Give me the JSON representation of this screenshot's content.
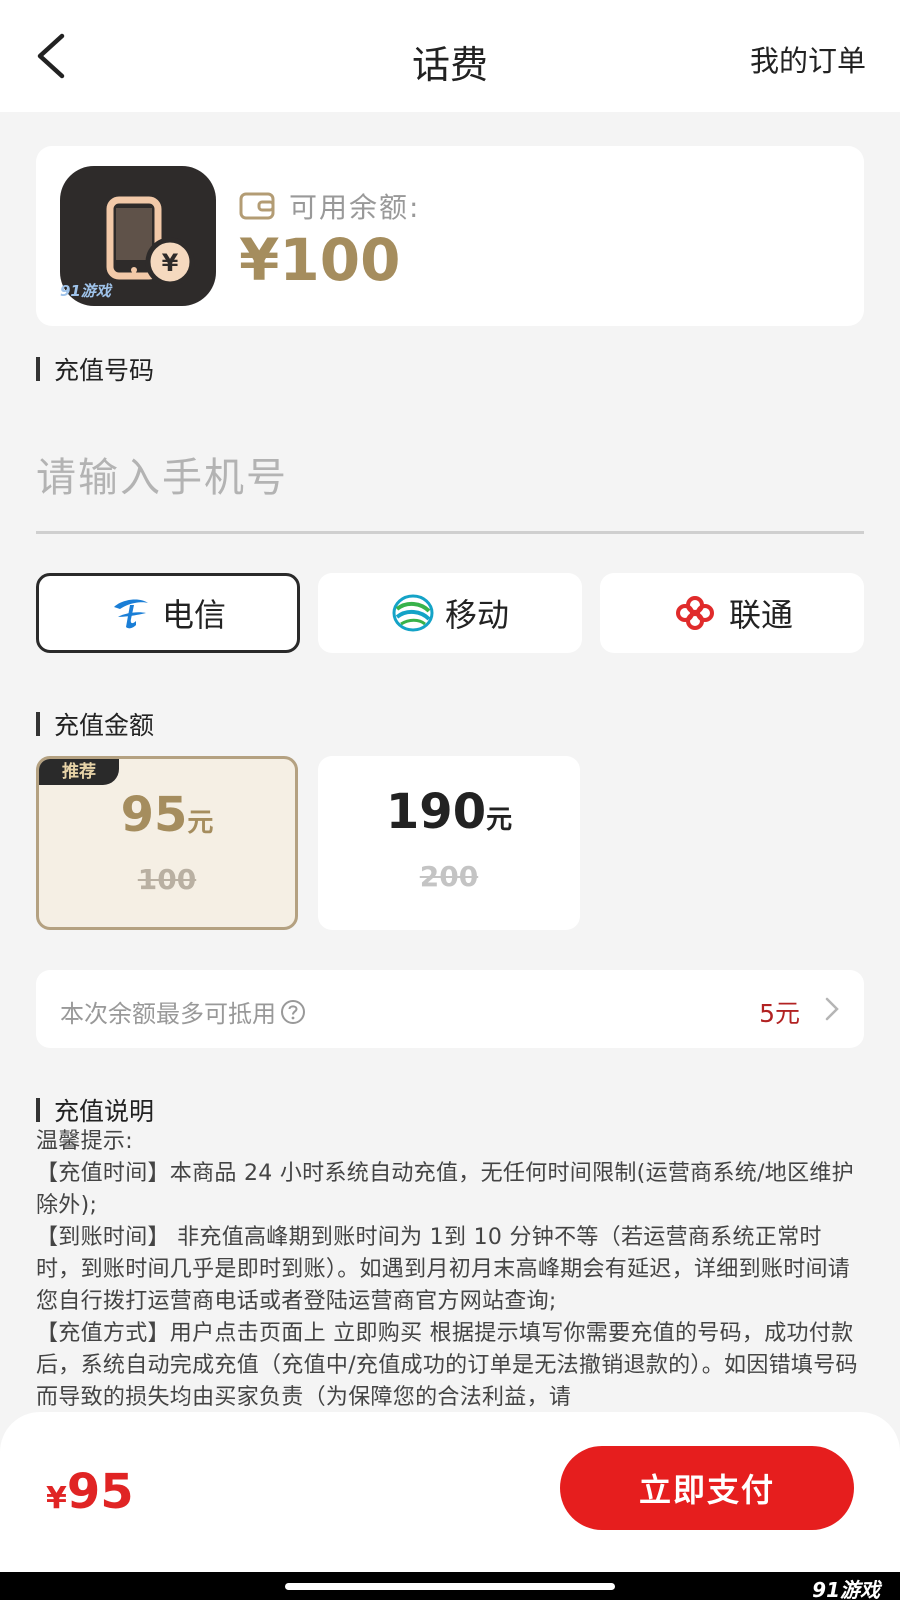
{
  "header": {
    "title": "话费",
    "orders_label": "我的订单"
  },
  "balance": {
    "label": "可用余额:",
    "amount": "¥100",
    "watermark": "91游戏"
  },
  "phone_section": {
    "title": "充值号码",
    "placeholder": "请输入手机号"
  },
  "carriers": [
    {
      "label": "电信",
      "selected": true
    },
    {
      "label": "移动",
      "selected": false
    },
    {
      "label": "联通",
      "selected": false
    }
  ],
  "amount_section": {
    "title": "充值金额",
    "options": [
      {
        "badge": "推荐",
        "price": "95",
        "unit": "元",
        "original": "100",
        "selected": true
      },
      {
        "price": "190",
        "unit": "元",
        "original": "200",
        "selected": false
      }
    ]
  },
  "deduct": {
    "label": "本次余额最多可抵用",
    "value": "5元"
  },
  "description": {
    "title": "充值说明",
    "lines": [
      "温馨提示:",
      "【充值时间】本商品 24 小时系统自动充值，无任何时间限制(运营商系统/地区维护除外);",
      "【到账时间】 非充值高峰期到账时间为 1到 10 分钟不等（若运营商系统正常时时，到账时间几乎是即时到账）。如遇到月初月末高峰期会有延迟，详细到账时间请您自行拨打运营商电话或者登陆运营商官方网站查询;",
      "【充值方式】用户点击页面上 立即购买 根据提示填写你需要充值的号码，成功付款后，系统自动完成充值（充值中/充值成功的订单是无法撤销退款的）。如因错填号码而导致的损失均由买家负责（为保障您的合法利益，请"
    ]
  },
  "footer": {
    "currency": "¥",
    "total": "95",
    "pay_label": "立即支付",
    "corner_mark": "91游戏"
  },
  "colors": {
    "accent_gold": "#a58d5e",
    "pay_red": "#e61e1e",
    "deduct_red": "#b22222"
  }
}
